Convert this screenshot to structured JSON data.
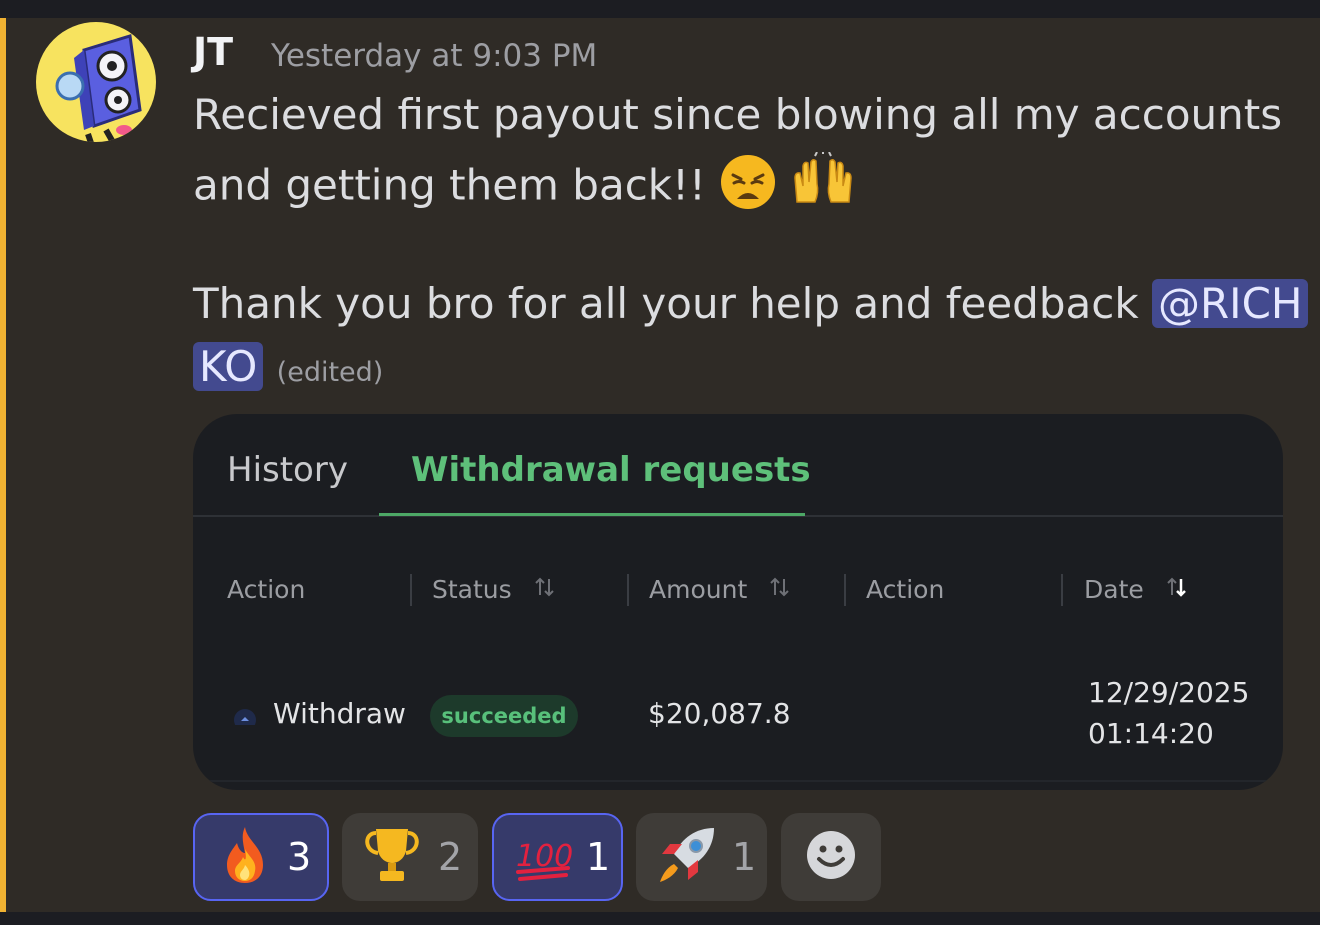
{
  "message": {
    "author": "JT",
    "timestamp": "Yesterday at 9:03 PM",
    "line1": "Recieved first payout since blowing all my accounts",
    "line2": "and getting them back!!",
    "line3": "Thank you bro for all your help and feedback",
    "mention_part1": "@RICH",
    "mention_part2": "KO",
    "edited": "(edited)",
    "accent_color": "#f0b232",
    "mention_color": "#434a8f"
  },
  "embed": {
    "tabs": [
      "History",
      "Withdrawal requests"
    ],
    "active_tab": "Withdrawal requests",
    "columns": [
      "Action",
      "Status",
      "Amount",
      "Action",
      "Date"
    ],
    "row": {
      "action": "Withdraw",
      "status": "succeeded",
      "amount": "$20,087.8",
      "date": "12/29/2025",
      "time": "01:14:20"
    },
    "accent_color": "#5ec07a"
  },
  "reactions": [
    {
      "icon": "fire-emoji",
      "count": "3",
      "reacted": true
    },
    {
      "icon": "trophy-emoji",
      "count": "2",
      "reacted": false
    },
    {
      "icon": "hundred-points-emoji",
      "count": "1",
      "reacted": true
    },
    {
      "icon": "rocket-emoji",
      "count": "1",
      "reacted": false
    }
  ],
  "add_reaction": {
    "icon": "add-reaction-smiley-icon"
  }
}
